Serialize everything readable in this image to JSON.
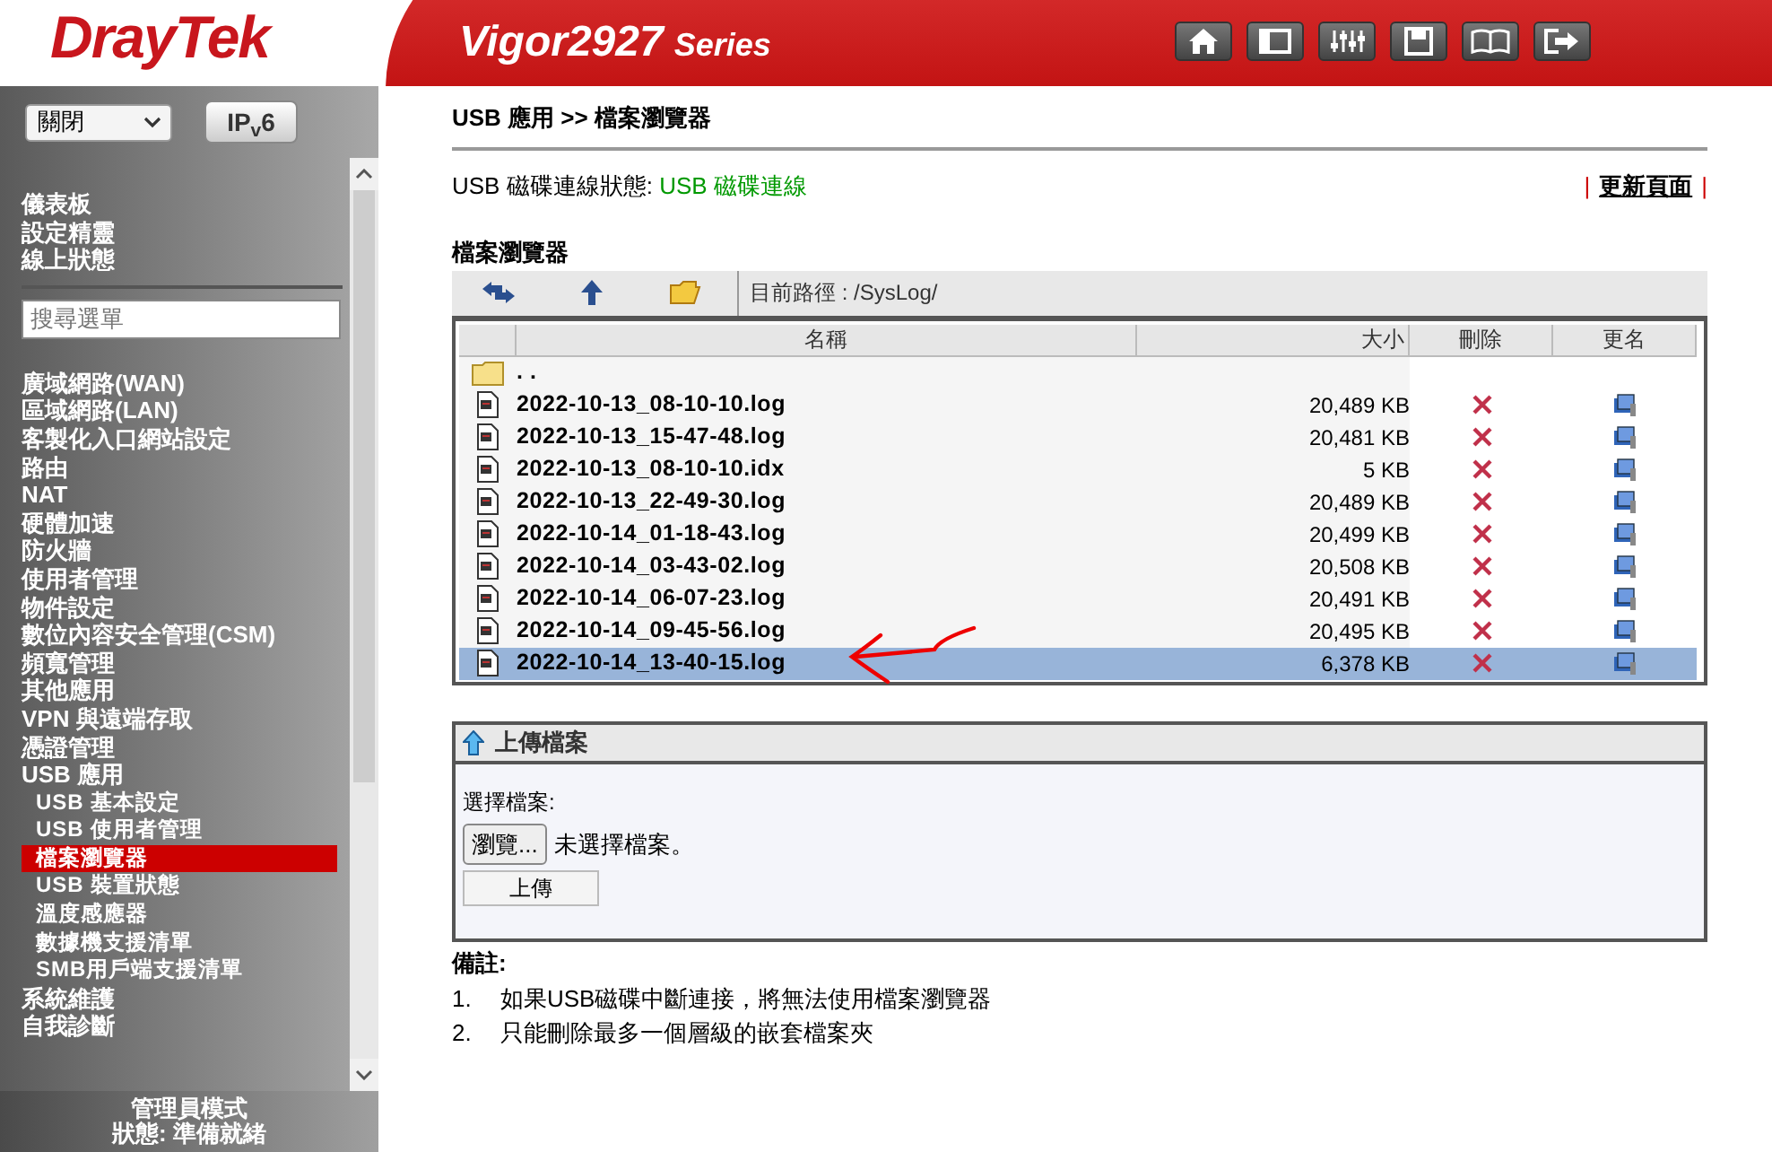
{
  "header": {
    "logo": "DrayTek",
    "model": "Vigor2927",
    "series": "Series"
  },
  "sidebar": {
    "mode_select": {
      "value": "關閉"
    },
    "ipv6_button": "IP$_{v}$6",
    "top_links": [
      "儀表板",
      "設定精靈",
      "線上狀態"
    ],
    "search": {
      "placeholder": "搜尋選單"
    },
    "menu": [
      {
        "label": "廣域網路(WAN)",
        "selected": false
      },
      {
        "label": "區域網路(LAN)",
        "selected": false
      },
      {
        "label": "客製化入口網站設定",
        "selected": false
      },
      {
        "label": "路由",
        "selected": false
      },
      {
        "label": "NAT",
        "selected": false
      },
      {
        "label": "硬體加速",
        "selected": false
      },
      {
        "label": "防火牆",
        "selected": false
      },
      {
        "label": "使用者管理",
        "selected": false
      },
      {
        "label": "物件設定",
        "selected": false
      },
      {
        "label": "數位內容安全管理(CSM)",
        "selected": false
      },
      {
        "label": "頻寬管理",
        "selected": false
      },
      {
        "label": "其他應用",
        "selected": false
      },
      {
        "label": "VPN 與遠端存取",
        "selected": false
      },
      {
        "label": "憑證管理",
        "selected": false
      },
      {
        "label": "USB 應用",
        "selected": false,
        "children": [
          {
            "label": "USB 基本設定",
            "selected": false
          },
          {
            "label": "USB 使用者管理",
            "selected": false
          },
          {
            "label": "檔案瀏覽器",
            "selected": true
          },
          {
            "label": "USB 裝置狀態",
            "selected": false
          },
          {
            "label": "溫度感應器",
            "selected": false
          },
          {
            "label": "數據機支援清單",
            "selected": false
          },
          {
            "label": "SMB用戶端支援清單",
            "selected": false
          }
        ]
      },
      {
        "label": "系統維護",
        "selected": false
      },
      {
        "label": "自我診斷",
        "selected": false
      }
    ],
    "footer": {
      "mode": "管理員模式",
      "status": "狀態: 準備就緒"
    }
  },
  "main": {
    "breadcrumb": "USB 應用 >> 檔案瀏覽器",
    "connection": {
      "label": "USB 磁碟連線狀態:",
      "value": "USB 磁碟連線"
    },
    "refresh": {
      "left_bar": "|",
      "link": "更新頁面",
      "right_bar": "|"
    },
    "section_title": "檔案瀏覽器",
    "path": "目前路徑 : /SysLog/",
    "table": {
      "columns": [
        "名稱",
        "大小",
        "刪除",
        "更名"
      ],
      "rows": [
        {
          "kind": "folder",
          "name": ". .",
          "size": "",
          "selected": false
        },
        {
          "kind": "file",
          "name": "2022-10-13_08-10-10.log",
          "size": "20,489 KB",
          "selected": false
        },
        {
          "kind": "file",
          "name": "2022-10-13_15-47-48.log",
          "size": "20,481 KB",
          "selected": false
        },
        {
          "kind": "file",
          "name": "2022-10-13_08-10-10.idx",
          "size": "5 KB",
          "selected": false
        },
        {
          "kind": "file",
          "name": "2022-10-13_22-49-30.log",
          "size": "20,489 KB",
          "selected": false
        },
        {
          "kind": "file",
          "name": "2022-10-14_01-18-43.log",
          "size": "20,499 KB",
          "selected": false
        },
        {
          "kind": "file",
          "name": "2022-10-14_03-43-02.log",
          "size": "20,508 KB",
          "selected": false
        },
        {
          "kind": "file",
          "name": "2022-10-14_06-07-23.log",
          "size": "20,491 KB",
          "selected": false
        },
        {
          "kind": "file",
          "name": "2022-10-14_09-45-56.log",
          "size": "20,495 KB",
          "selected": false
        },
        {
          "kind": "file",
          "name": "2022-10-14_13-40-15.log",
          "size": "6,378 KB",
          "selected": true
        }
      ]
    },
    "upload": {
      "title": "上傳檔案",
      "label": "選擇檔案:",
      "browse": "瀏覽...",
      "no_file": "未選擇檔案。",
      "button": "上傳"
    },
    "notes": {
      "title": "備註:",
      "items": [
        {
          "number": "1.",
          "text": "如果USB磁碟中斷連接，將無法使用檔案瀏覽器"
        },
        {
          "number": "2.",
          "text": "只能刪除最多一個層級的嵌套檔案夾"
        }
      ]
    }
  }
}
